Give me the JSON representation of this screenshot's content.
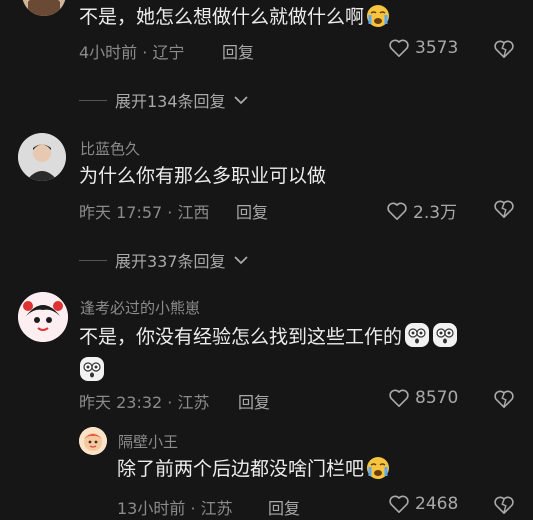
{
  "comments": [
    {
      "text": "不是，她怎么想做什么就做什么啊",
      "time": "4小时前",
      "location": "辽宁",
      "reply_label": "回复",
      "likes": "3573",
      "expand_label": "展开134条回复"
    },
    {
      "username": "比蓝色久",
      "text": "为什么你有那么多职业可以做",
      "time": "昨天 17:57",
      "location": "江西",
      "reply_label": "回复",
      "likes": "2.3万",
      "expand_label": "展开337条回复"
    },
    {
      "username": "逢考必过的小熊崽",
      "text": "不是，你没有经验怎么找到这些工作的",
      "time": "昨天 23:32",
      "location": "江苏",
      "reply_label": "回复",
      "likes": "8570"
    }
  ],
  "reply": {
    "username": "隔壁小王",
    "text": "除了前两个后边都没啥门栏吧",
    "time": "13小时前",
    "location": "江苏",
    "reply_label": "回复",
    "likes": "2468"
  },
  "separator": " · ",
  "icons": {
    "like": "heart-outline-icon",
    "dislike": "broken-heart-icon",
    "expand": "chevron-down-icon",
    "emoji_cry": "crying-face-emoji",
    "emoji_shocked": "shocked-face-emoji"
  },
  "colors": {
    "background": "#161616",
    "primary_text": "#ececec",
    "secondary_text": "#8b8b8b"
  }
}
